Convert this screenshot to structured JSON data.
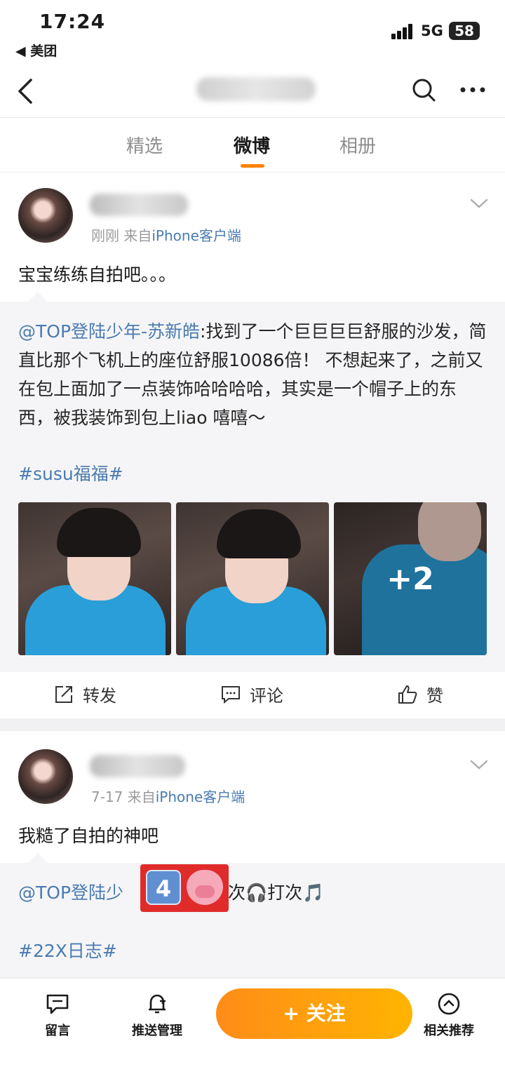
{
  "status_bar": {
    "time": "17:24",
    "back_app": "◀ 美团",
    "network": "5G",
    "battery": "58"
  },
  "nav": {
    "title": ""
  },
  "tabs": [
    {
      "label": "精选",
      "active": false
    },
    {
      "label": "微博",
      "active": true
    },
    {
      "label": "相册",
      "active": false
    }
  ],
  "posts": [
    {
      "time": "刚刚",
      "source_prefix": "来自",
      "source": "iPhone客户端",
      "text": "宝宝练练自拍吧。。。",
      "repost": {
        "mention": "@TOP登陆少年-苏新皓",
        "body": ":找到了一个巨巨巨巨舒服的沙发，简直比那个飞机上的座位舒服10086倍！ 不想起来了，之前又在包上面加了一点装饰哈哈哈哈，其实是一个帽子上的东西，被我装饰到包上liao 嘻嘻～",
        "hashtag": "#susu福福#",
        "more_images": "+2"
      },
      "actions": {
        "repost": "转发",
        "comment": "评论",
        "like": "赞"
      }
    },
    {
      "time": "7-17",
      "source_prefix": "来自",
      "source": "iPhone客户端",
      "text": "我糙了自拍的神吧",
      "repost": {
        "mention": "@TOP登陆少",
        "body_tail": "动次🎧打次🎵",
        "sticker_number": "4",
        "hashtag": "#22X日志#"
      }
    }
  ],
  "bottom_bar": {
    "message": "留言",
    "push": "推送管理",
    "follow": "+ 关注",
    "related": "相关推荐"
  },
  "colors": {
    "accent": "#ff8200",
    "link": "#4a7bb0",
    "follow_start": "#ff8c19",
    "follow_end": "#ffb400"
  }
}
